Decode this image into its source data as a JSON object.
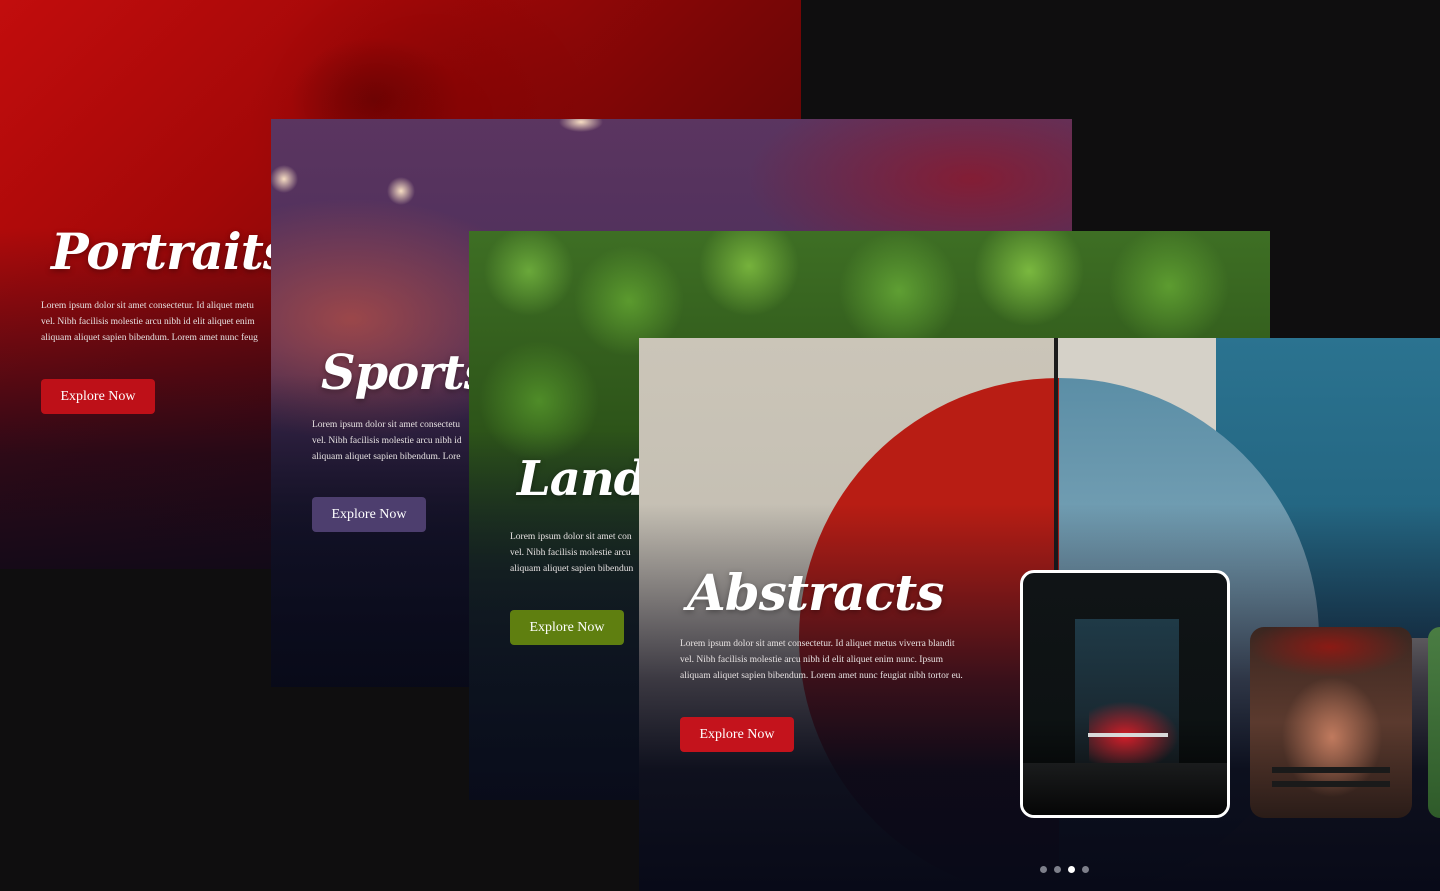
{
  "cards": [
    {
      "id": "portraits",
      "title": "Portraits",
      "body": [
        "Lorem ipsum dolor sit amet consectetur. Id aliquet metu",
        "vel. Nibh facilisis molestie arcu nibh id elit aliquet enim",
        "aliquam aliquet sapien bibendum. Lorem amet nunc feug"
      ],
      "button": "Explore Now",
      "accent": "#be1018"
    },
    {
      "id": "sports",
      "title": "Sports",
      "body": [
        "Lorem ipsum dolor sit amet consectetu",
        "vel. Nibh facilisis molestie arcu nibh id",
        "aliquam aliquet sapien bibendum. Lore"
      ],
      "button": "Explore Now",
      "accent": "#4d3e6e"
    },
    {
      "id": "landscapes",
      "title": "Lands",
      "body": [
        "Lorem ipsum dolor sit amet con",
        "vel. Nibh facilisis molestie arcu",
        "aliquam aliquet sapien bibendun"
      ],
      "button": "Explore Now",
      "accent": "#5f7f10"
    },
    {
      "id": "abstracts",
      "title": "Abstracts",
      "body": [
        "Lorem ipsum dolor sit amet consectetur. Id aliquet metus viverra blandit",
        "vel. Nibh facilisis molestie arcu nibh id elit aliquet enim nunc. Ipsum",
        "aliquam aliquet sapien bibendum. Lorem amet nunc feugiat nibh tortor eu."
      ],
      "button": "Explore Now",
      "accent": "#c4131c"
    }
  ],
  "carousel": {
    "thumbnails": [
      "abstract-room-image",
      "football-player-image",
      "landscape-image"
    ],
    "selected_thumbnail": 1,
    "dots": 4,
    "active_dot": 3
  }
}
